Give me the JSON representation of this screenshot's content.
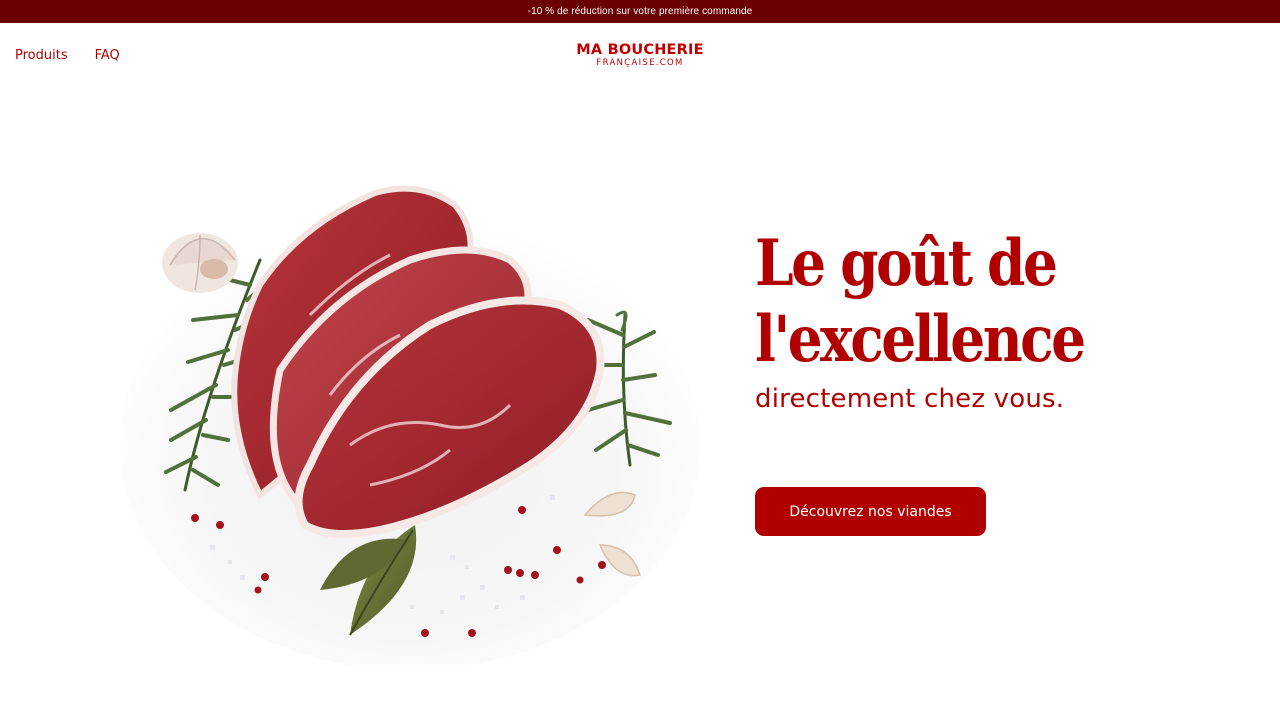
{
  "promo_bar": {
    "text": "-10 % de réduction sur votre première commande"
  },
  "nav": {
    "items": [
      {
        "label": "Produits"
      },
      {
        "label": "FAQ"
      }
    ]
  },
  "logo": {
    "main": "MA BOUCHERIE",
    "sub": "FRANÇAISE.COM"
  },
  "hero": {
    "headline_line1": "Le goût de",
    "headline_line2": "l'excellence",
    "subline": "directement chez vous.",
    "cta_label": "Découvrez nos viandes",
    "image": "raw-beef-steaks-with-rosemary-garlic-peppercorns"
  },
  "colors": {
    "promo_bg": "#6b0000",
    "brand_red": "#b00000",
    "background": "#ffffff"
  }
}
